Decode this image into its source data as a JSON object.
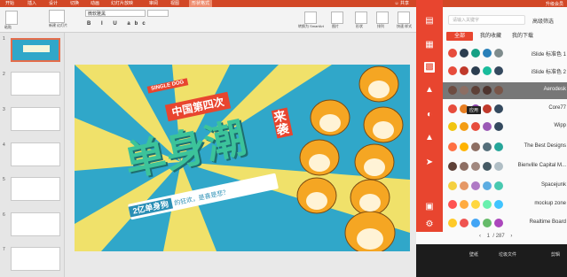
{
  "ribbon": {
    "tabs": [
      "开始",
      "插入",
      "设计",
      "切换",
      "动画",
      "幻灯片放映",
      "审阅",
      "视图",
      "形状格式"
    ],
    "share": "共享",
    "font_name": "微软雅黑",
    "items": {
      "paste": "粘贴",
      "new_slide": "新建\n幻灯片",
      "convert": "转换为\nSmartArt",
      "picture": "图片",
      "shape": "形状",
      "arrange": "排列",
      "quick_style": "快速\n样式"
    }
  },
  "thumbnails": {
    "numbers": [
      "1",
      "2",
      "3",
      "4",
      "5",
      "6",
      "7"
    ]
  },
  "slide": {
    "badge": "SINGLE DOG",
    "line1": "中国第四次",
    "headline": "单身潮",
    "side": "来袭",
    "banner_strong": "2亿单身狗",
    "banner_rest": "的狂欢，是喜是悲？"
  },
  "panel": {
    "top_right": "升级会员",
    "search_placeholder": "请输入关键字",
    "advanced": "高级筛选",
    "filter_tabs": [
      "全部",
      "我的收藏",
      "我的下载"
    ],
    "palettes": [
      {
        "name": "iSlide 标准色 1",
        "colors": [
          "#e74c3c",
          "#2c3e50",
          "#16a085",
          "#2980b9",
          "#7f8c8d"
        ]
      },
      {
        "name": "iSlide 标准色 2",
        "colors": [
          "#e74c3c",
          "#c0392b",
          "#2c3e50",
          "#1abc9c",
          "#34495e"
        ]
      },
      {
        "name": "Aerodesk",
        "colors": [
          "#6d4c41",
          "#8d6e63",
          "#5d4037",
          "#4e342e",
          "#795548"
        ]
      },
      {
        "name": "Core77",
        "colors": [
          "#e74c3c",
          "#e67e22",
          "#8e44ad",
          "#c0392b",
          "#34495e"
        ]
      },
      {
        "name": "Wipp",
        "colors": [
          "#f1c40f",
          "#f39c12",
          "#e74c3c",
          "#9b59b6",
          "#34495e"
        ]
      },
      {
        "name": "The Best Designs",
        "colors": [
          "#ff7043",
          "#ffb300",
          "#8d6e63",
          "#546e7a",
          "#26a69a"
        ]
      },
      {
        "name": "Bienville Capital M...",
        "colors": [
          "#5d4037",
          "#8d6e63",
          "#a1887f",
          "#455a64",
          "#b0bec5"
        ]
      },
      {
        "name": "Spacejunk",
        "colors": [
          "#f4d03f",
          "#e59866",
          "#af7ac5",
          "#5dade2",
          "#48c9b0"
        ]
      },
      {
        "name": "mockup zone",
        "colors": [
          "#ff5252",
          "#ffab40",
          "#ffd740",
          "#69f0ae",
          "#40c4ff"
        ]
      },
      {
        "name": "Realtime Board",
        "colors": [
          "#ffca28",
          "#ef5350",
          "#42a5f5",
          "#66bb6a",
          "#ab47bc"
        ]
      }
    ],
    "tooltip": "应用",
    "pager": {
      "current": "1",
      "total": "287"
    },
    "bottom": [
      "壁纸",
      "垃圾文件",
      "剪辑"
    ]
  }
}
